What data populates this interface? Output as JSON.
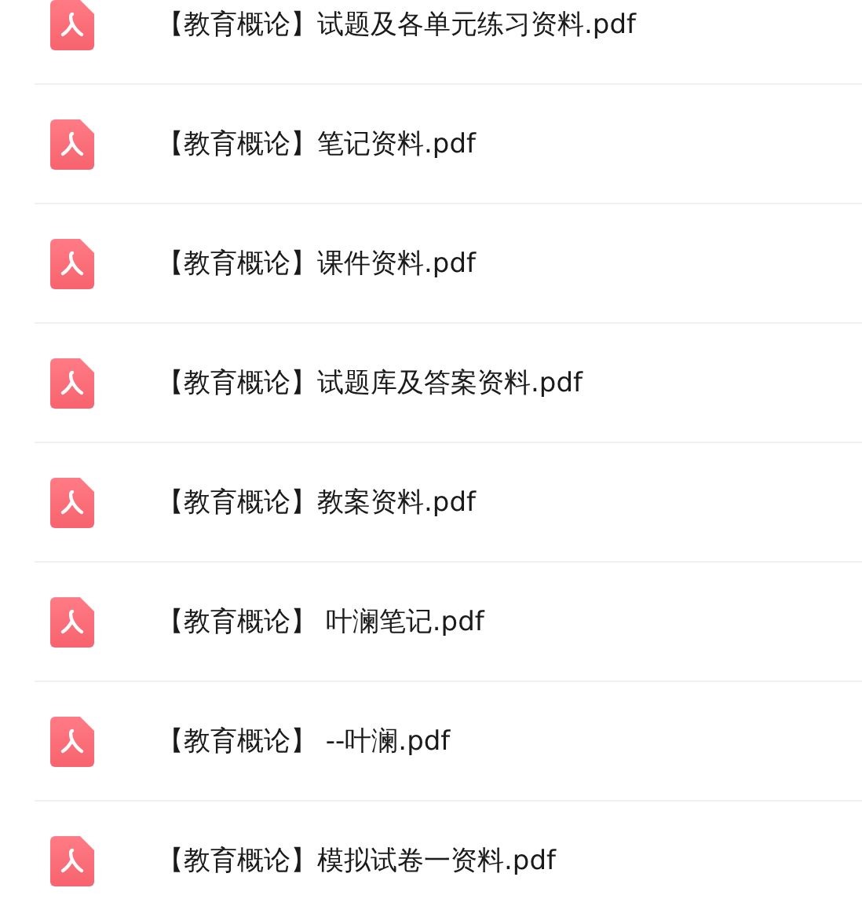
{
  "files": [
    {
      "name": "【教育概论】试题及各单元练习资料.pdf"
    },
    {
      "name": "【教育概论】笔记资料.pdf"
    },
    {
      "name": "【教育概论】课件资料.pdf"
    },
    {
      "name": "【教育概论】试题库及答案资料.pdf"
    },
    {
      "name": "【教育概论】教案资料.pdf"
    },
    {
      "name": "【教育概论】 叶澜笔记.pdf"
    },
    {
      "name": "【教育概论】 --叶澜.pdf"
    },
    {
      "name": "【教育概论】模拟试卷一资料.pdf"
    }
  ]
}
